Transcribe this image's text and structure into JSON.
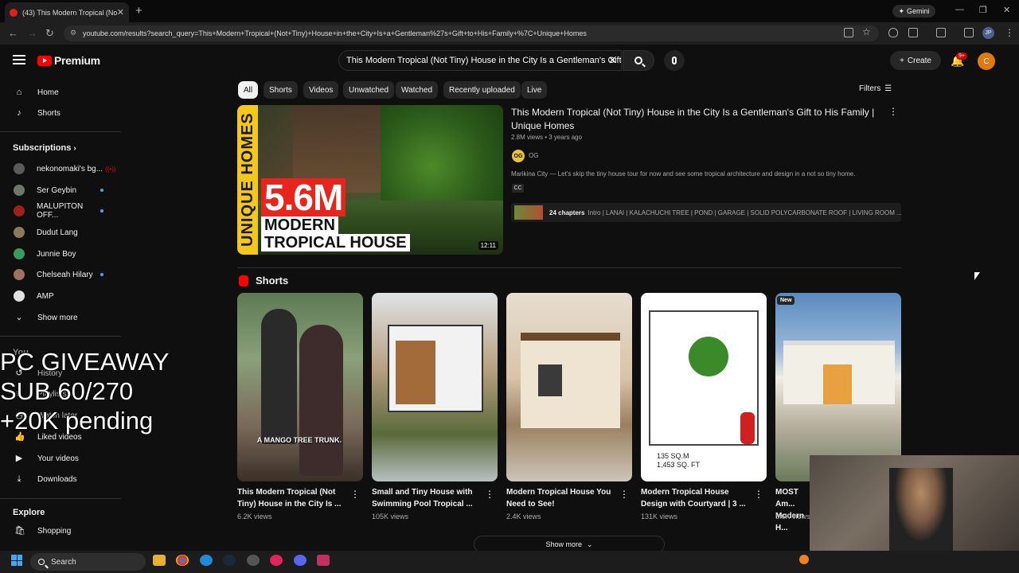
{
  "browser": {
    "tab_title": "(43) This Modern Tropical (Not",
    "new_tab": "+",
    "gemini_label": "Gemini",
    "url": "youtube.com/results?search_query=This+Modern+Tropical+(Not+Tiny)+House+in+the+City+Is+a+Gentleman%27s+Gift+to+His+Family+%7C+Unique+Homes",
    "profile_initials": "JP"
  },
  "header": {
    "logo_text": "Premium",
    "search_query": "This Modern Tropical (Not Tiny) House in the City Is a Gentleman's Gift",
    "create_label": "Create",
    "notification_badge": "9+",
    "avatar_letter": "C"
  },
  "sidebar": {
    "top": [
      {
        "label": "Home",
        "icon": "home-icon"
      },
      {
        "label": "Shorts",
        "icon": "shorts-icon"
      }
    ],
    "subscriptions_title": "Subscriptions",
    "subscriptions": [
      {
        "label": "nekonomaki's bg...",
        "color": "#5a5a5a"
      },
      {
        "label": "Ser Geybin",
        "color": "#6a7a6a"
      },
      {
        "label": "MALUPITON OFF...",
        "color": "#a02020"
      },
      {
        "label": "Dudut Lang",
        "color": "#8a7a5a"
      },
      {
        "label": "Junnie Boy",
        "color": "#3a9a5a"
      },
      {
        "label": "Chelseah Hilary",
        "color": "#a07060"
      },
      {
        "label": "AMP",
        "color": "#e0e0e0"
      }
    ],
    "show_more": "Show more",
    "you_title": "You",
    "you_items": [
      {
        "label": "History"
      },
      {
        "label": "Playlists"
      },
      {
        "label": "Watch later"
      },
      {
        "label": "Liked videos"
      },
      {
        "label": "Your videos"
      },
      {
        "label": "Downloads"
      }
    ],
    "explore_title": "Explore",
    "explore_items": [
      {
        "label": "Shopping"
      }
    ]
  },
  "overlay": {
    "line1": "PC GIVEAWAY",
    "line2": "SUB 60/270",
    "line3": "+20K pending"
  },
  "chips": [
    "All",
    "Shorts",
    "Videos",
    "Unwatched",
    "Watched",
    "Recently uploaded",
    "Live"
  ],
  "filters_label": "Filters",
  "main_video": {
    "thumb_side": "UNIQUE HOMES",
    "thumb_big": "5.6M",
    "thumb_line2": "MODERN",
    "thumb_line3": "TROPICAL HOUSE",
    "duration": "12:11",
    "title": "This Modern Tropical (Not Tiny) House in the City Is a Gentleman's Gift to His Family | Unique Homes",
    "meta": "2.8M views • 3 years ago",
    "channel_avatar": "OG",
    "channel": "OG",
    "description": "Marikina City — Let's skip the tiny house tour for now and see some tropical architecture and design in a not so tiny home.",
    "cc": "CC",
    "chapters_count": "24 chapters",
    "chapters_text": "Intro | LANAI | KALACHUCHI TREE | POND | GARAGE | SOLID POLYCARBONATE ROOF | LIVING ROOM ..."
  },
  "shorts": {
    "title": "Shorts",
    "thumb_caption": "A MANGO TREE TRUNK.",
    "plan_caption_1": "135 SQ.M",
    "plan_caption_2": "1,453 SQ. FT",
    "new_badge": "New",
    "items": [
      {
        "title": "This Modern Tropical (Not Tiny) House in the City Is ...",
        "views": "6.2K views"
      },
      {
        "title": "Small and Tiny House with Swimming Pool Tropical ...",
        "views": "105K views"
      },
      {
        "title": "Modern Tropical House You Need to See!",
        "views": "2.4K views"
      },
      {
        "title": "Modern Tropical House Design with Courtyard | 3 ...",
        "views": "131K views"
      },
      {
        "title": "MOST Am... Modern H...",
        "views": "8.6K views"
      }
    ],
    "show_more": "Show more"
  },
  "taskbar": {
    "search_label": "Search"
  }
}
